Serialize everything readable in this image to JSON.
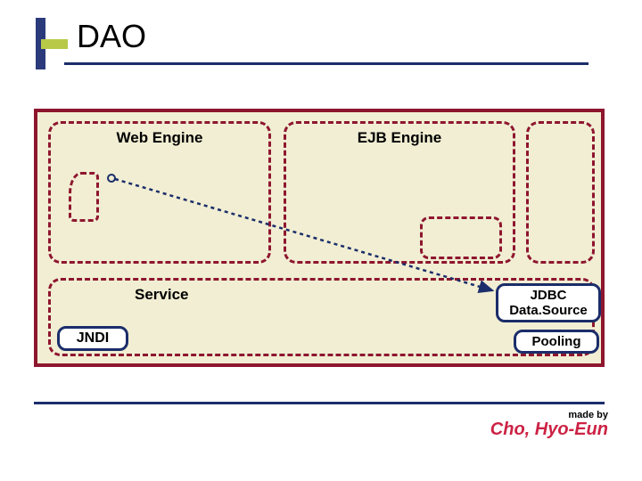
{
  "title": "DAO",
  "boxes": {
    "web_engine": "Web Engine",
    "ejb_engine": "EJB Engine",
    "service": "Service"
  },
  "pills": {
    "jndi": "JNDI",
    "jdbc_line1": "JDBC",
    "jdbc_line2": "Data.Source",
    "pooling": "Pooling"
  },
  "signature": {
    "made_by": "made by",
    "author": "Cho, Hyo-Eun"
  },
  "colors": {
    "darkred": "#8e162e",
    "navy": "#1b2d6a",
    "beige": "#f1eed3",
    "olive": "#b8c948",
    "sigred": "#cc2244"
  }
}
